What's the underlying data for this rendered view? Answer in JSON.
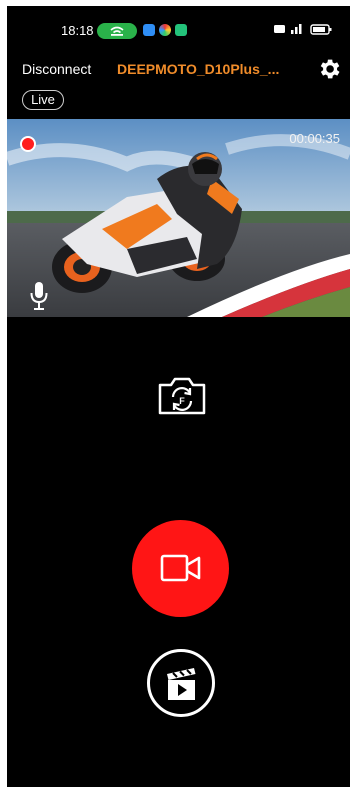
{
  "status_bar": {
    "time": "18:18",
    "right_icons": "HD ²ᴳ ▎▐ ▭"
  },
  "top_bar": {
    "disconnect_label": "Disconnect",
    "device_name": "DEEPMOTO_D10Plus_...",
    "settings_icon": "gear-icon"
  },
  "mode_badge": "Live",
  "preview": {
    "recording_indicator_color": "#ff1e1e",
    "timer": "00:00:35",
    "mic_icon": "microphone-icon"
  },
  "controls": {
    "switch_camera_icon": "camera-switch-icon",
    "record_icon": "video-camera-icon",
    "record_color": "#ff1515",
    "gallery_icon": "video-gallery-icon"
  },
  "colors": {
    "accent_orange": "#f08c2a",
    "status_pill_green": "#2ab24a",
    "background": "#000000"
  }
}
